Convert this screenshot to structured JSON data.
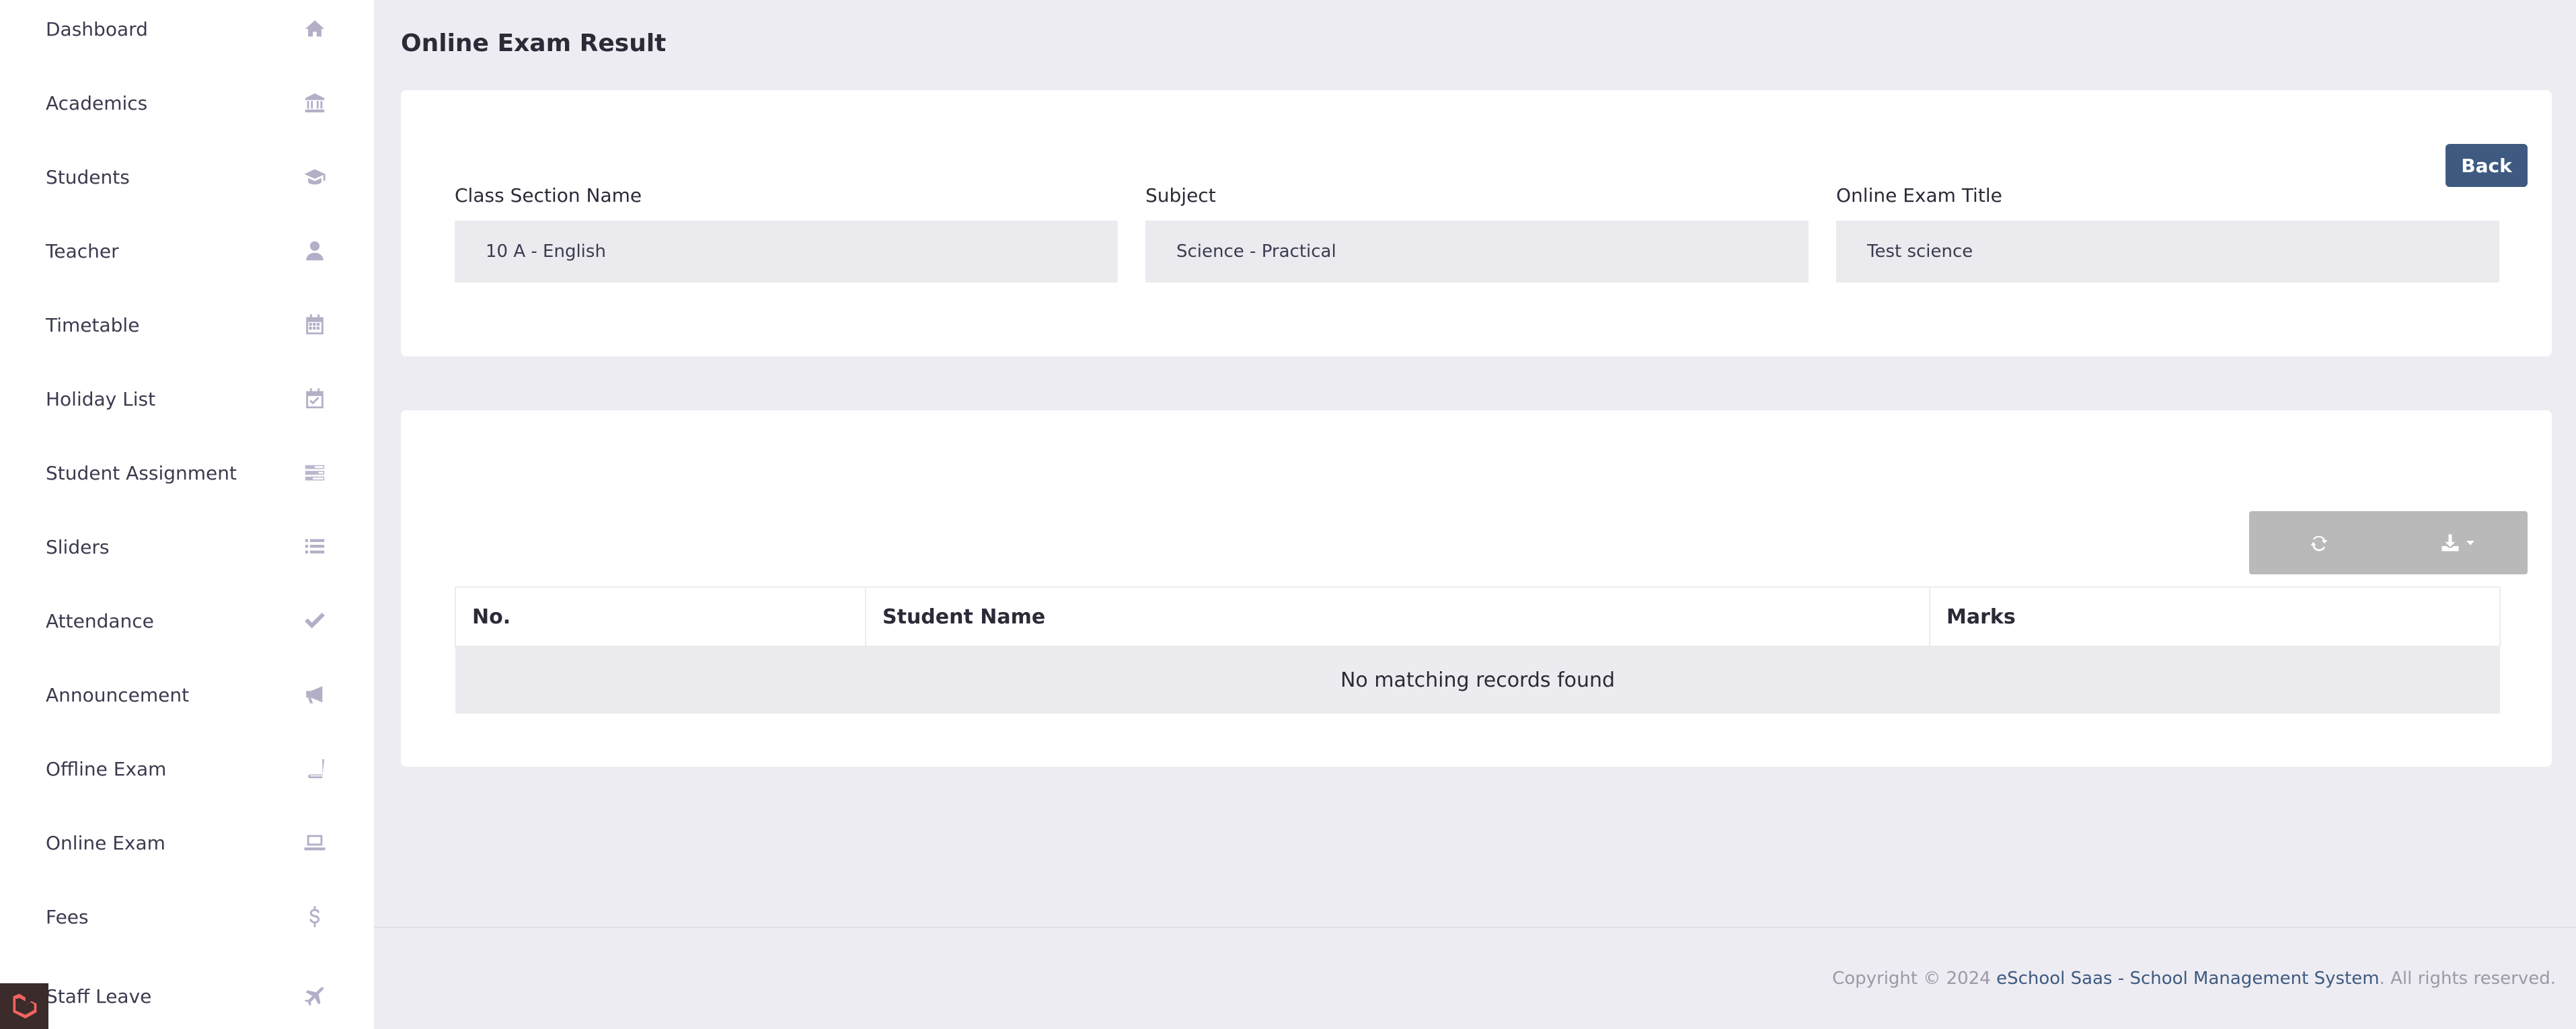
{
  "sidebar": {
    "items": [
      {
        "label": "Dashboard",
        "icon": "home-icon"
      },
      {
        "label": "Academics",
        "icon": "university-icon"
      },
      {
        "label": "Students",
        "icon": "graduation-cap-icon"
      },
      {
        "label": "Teacher",
        "icon": "user-icon"
      },
      {
        "label": "Timetable",
        "icon": "calendar-grid-icon"
      },
      {
        "label": "Holiday List",
        "icon": "calendar-check-icon"
      },
      {
        "label": "Student Assignment",
        "icon": "tasks-icon"
      },
      {
        "label": "Sliders",
        "icon": "list-icon"
      },
      {
        "label": "Attendance",
        "icon": "check-icon"
      },
      {
        "label": "Announcement",
        "icon": "bullhorn-icon"
      },
      {
        "label": "Offline Exam",
        "icon": "book-icon"
      },
      {
        "label": "Online Exam",
        "icon": "laptop-icon"
      },
      {
        "label": "Fees",
        "icon": "dollar-icon"
      },
      {
        "label": "Staff Leave",
        "icon": "plane-icon"
      }
    ]
  },
  "header": {
    "title": "Online Exam Result"
  },
  "filters": {
    "back_label": "Back",
    "class_section": {
      "label": "Class Section Name",
      "value": "10 A - English"
    },
    "subject": {
      "label": "Subject",
      "value": "Science - Practical"
    },
    "exam_title": {
      "label": "Online Exam Title",
      "value": "Test science"
    }
  },
  "table": {
    "toolbar": {
      "refresh_icon": "refresh-icon",
      "export_icon": "download-icon"
    },
    "columns": [
      "No.",
      "Student Name",
      "Marks"
    ],
    "empty_message": "No matching records found"
  },
  "footer": {
    "prefix": "Copyright © 2024 ",
    "brand": "eSchool Saas - School Management System",
    "suffix": ". All rights reserved."
  }
}
